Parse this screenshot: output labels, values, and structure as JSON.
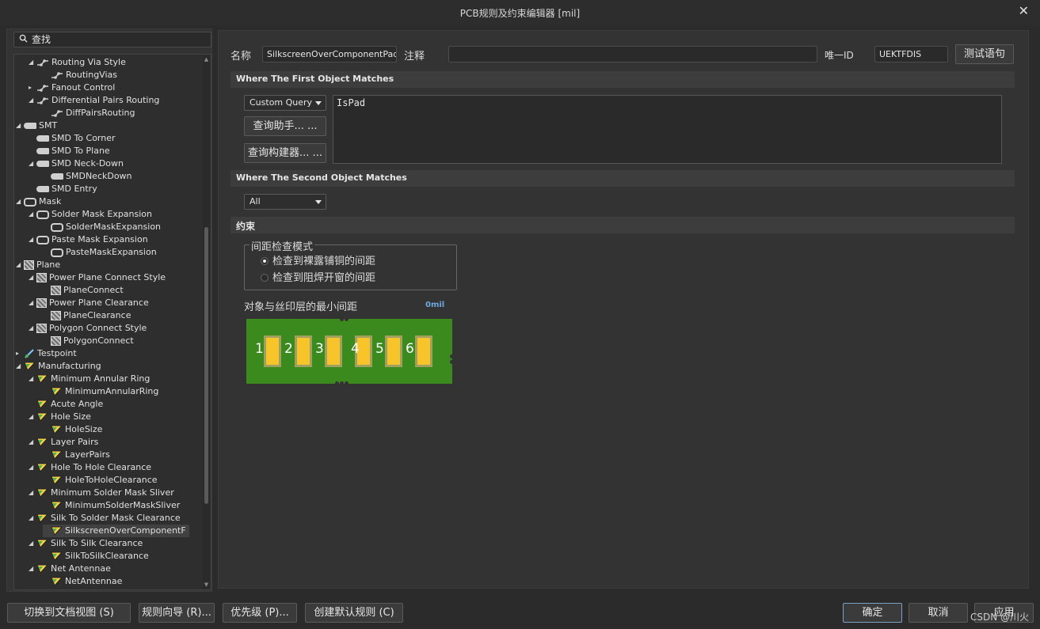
{
  "window": {
    "title": "PCB规则及约束编辑器 [mil]"
  },
  "search": {
    "placeholder": "查找"
  },
  "tree": [
    {
      "label": "Routing Via Style",
      "icon": "route"
    },
    {
      "label": "RoutingVias",
      "icon": "route"
    },
    {
      "label": "Fanout Control",
      "icon": "route"
    },
    {
      "label": "Differential Pairs Routing",
      "icon": "route"
    },
    {
      "label": "DiffPairsRouting",
      "icon": "route"
    },
    {
      "label": "SMT",
      "icon": "smt"
    },
    {
      "label": "SMD To Corner",
      "icon": "smt"
    },
    {
      "label": "SMD To Plane",
      "icon": "smt"
    },
    {
      "label": "SMD Neck-Down",
      "icon": "smt"
    },
    {
      "label": "SMDNeckDown",
      "icon": "smt"
    },
    {
      "label": "SMD Entry",
      "icon": "smt"
    },
    {
      "label": "Mask",
      "icon": "mask"
    },
    {
      "label": "Solder Mask Expansion",
      "icon": "mask"
    },
    {
      "label": "SolderMaskExpansion",
      "icon": "mask"
    },
    {
      "label": "Paste Mask Expansion",
      "icon": "mask"
    },
    {
      "label": "PasteMaskExpansion",
      "icon": "mask"
    },
    {
      "label": "Plane",
      "icon": "plane"
    },
    {
      "label": "Power Plane Connect Style",
      "icon": "plane"
    },
    {
      "label": "PlaneConnect",
      "icon": "plane"
    },
    {
      "label": "Power Plane Clearance",
      "icon": "plane"
    },
    {
      "label": "PlaneClearance",
      "icon": "plane"
    },
    {
      "label": "Polygon Connect Style",
      "icon": "plane"
    },
    {
      "label": "PolygonConnect",
      "icon": "plane"
    },
    {
      "label": "Testpoint",
      "icon": "test"
    },
    {
      "label": "Manufacturing",
      "icon": "mfg"
    },
    {
      "label": "Minimum Annular Ring",
      "icon": "mfg"
    },
    {
      "label": "MinimumAnnularRing",
      "icon": "mfg"
    },
    {
      "label": "Acute Angle",
      "icon": "mfg"
    },
    {
      "label": "Hole Size",
      "icon": "mfg"
    },
    {
      "label": "HoleSize",
      "icon": "mfg"
    },
    {
      "label": "Layer Pairs",
      "icon": "mfg"
    },
    {
      "label": "LayerPairs",
      "icon": "mfg"
    },
    {
      "label": "Hole To Hole Clearance",
      "icon": "mfg"
    },
    {
      "label": "HoleToHoleClearance",
      "icon": "mfg"
    },
    {
      "label": "Minimum Solder Mask Sliver",
      "icon": "mfg"
    },
    {
      "label": "MinimumSolderMaskSliver",
      "icon": "mfg"
    },
    {
      "label": "Silk To Solder Mask Clearance",
      "icon": "mfg"
    },
    {
      "label": "SilkscreenOverComponentF",
      "icon": "mfg"
    },
    {
      "label": "Silk To Silk Clearance",
      "icon": "mfg"
    },
    {
      "label": "SilkToSilkClearance",
      "icon": "mfg"
    },
    {
      "label": "Net Antennae",
      "icon": "mfg"
    },
    {
      "label": "NetAntennae",
      "icon": "mfg"
    }
  ],
  "rule": {
    "name_label": "名称",
    "name_value": "SilkscreenOverComponentPads",
    "comment_label": "注释",
    "comment_value": "",
    "uid_label": "唯一ID",
    "uid_value": "UEKTFDIS",
    "test_button": "测试语句"
  },
  "first": {
    "header": "Where The First Object Matches",
    "query_type": "Custom Query",
    "helper_button": "查询助手... ...",
    "builder_button": "查询构建器... ...",
    "query_text": "IsPad"
  },
  "second": {
    "header": "Where The Second Object Matches",
    "scope": "All"
  },
  "constraints": {
    "header": "约束",
    "mode_legend": "间距检查模式",
    "option1": "检查到裸露铺铜的间距",
    "option2": "检查到阻焊开窗的间距",
    "min_label": "对象与丝印层的最小间距",
    "min_value": "0mil",
    "pads": [
      "1",
      "2",
      "3",
      "4",
      "5",
      "6"
    ],
    "pad_color": "#f7c52a",
    "board_color": "#3a8a1e",
    "accent": "#6fa8dc"
  },
  "footer": {
    "doc_view": "切换到文档视图 (S)",
    "rule_wizard": "规则向导 (R)...",
    "priority": "优先级 (P)...",
    "create_default": "创建默认规则 (C)",
    "ok": "确定",
    "cancel": "取消",
    "apply": "应用"
  },
  "watermark": "CSDN @川火"
}
